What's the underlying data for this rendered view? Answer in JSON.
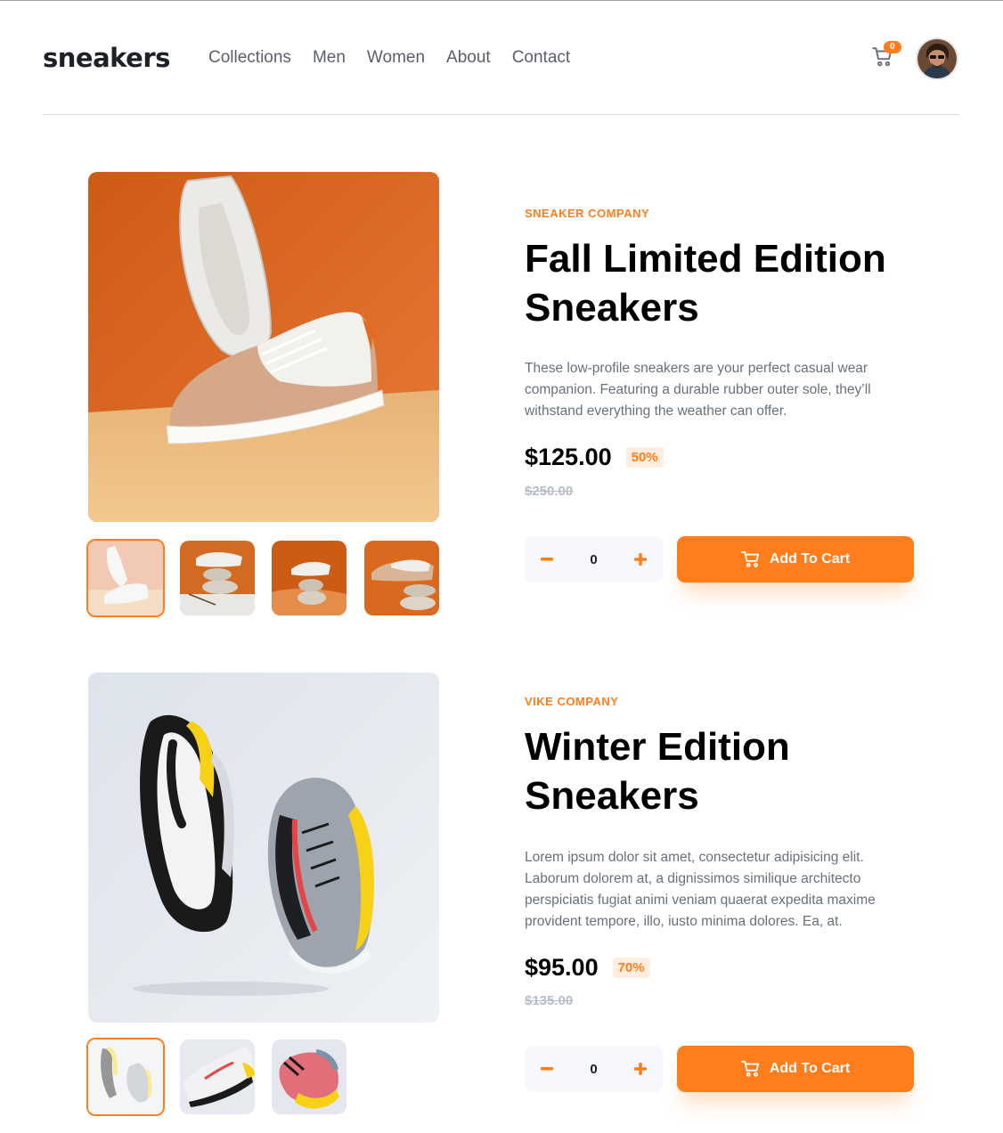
{
  "header": {
    "logo": "sneakers",
    "nav": [
      "Collections",
      "Men",
      "Women",
      "About",
      "Contact"
    ],
    "cart_count": "0"
  },
  "products": [
    {
      "company": "SNEAKER COMPANY",
      "title_line1": "Fall Limited Edition",
      "title_line2": "Sneakers",
      "description": "These low-profile sneakers are your perfect casual wear companion. Featuring a durable rubber outer sole, they’ll withstand everything the weather can offer.",
      "price": "$125.00",
      "discount": "50%",
      "old_price": "$250.00",
      "quantity": "0",
      "add_label": "Add To Cart"
    },
    {
      "company": "VIKE COMPANY",
      "title_line1": "Winter Edition",
      "title_line2": "Sneakers",
      "description": "Lorem ipsum dolor sit amet, consectetur adipisicing elit. Laborum dolorem at, a dignissimos similique architecto perspiciatis fugiat animi veniam quaerat expedita maxime provident tempore, illo, iusto minima dolores. Ea, at.",
      "price": "$95.00",
      "discount": "70%",
      "old_price": "$135.00",
      "quantity": "0",
      "add_label": "Add To Cart"
    }
  ],
  "colors": {
    "accent": "#ff7e1b",
    "accent_pale": "#ffede0",
    "text_dark": "#1d2026",
    "text_muted": "#68707d"
  }
}
